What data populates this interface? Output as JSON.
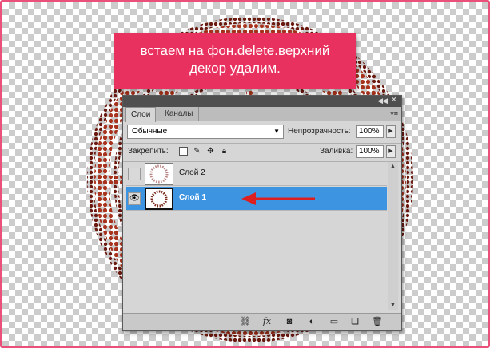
{
  "caption": {
    "line1": "встаем на фон.delete.верхний",
    "line2": "декор удалим."
  },
  "panel": {
    "tabs": [
      {
        "label": "Слои",
        "active": true
      },
      {
        "label": "Каналы",
        "active": false
      }
    ],
    "blend_mode": "Обычные",
    "opacity_label": "Непрозрачность:",
    "opacity_value": "100%",
    "lock_label": "Закрепить:",
    "fill_label": "Заливка:",
    "fill_value": "100%",
    "layers": [
      {
        "name": "Слой 2",
        "visible": false,
        "selected": false
      },
      {
        "name": "Слой 1",
        "visible": true,
        "selected": true
      }
    ]
  },
  "colors": {
    "accent": "#e8315f",
    "frame": "#e9507a",
    "selection": "#3d94e0",
    "arrow": "#dd1f1f"
  },
  "icons": {
    "lock_buttons": [
      "lock-transparent-icon",
      "lock-image-icon",
      "lock-position-icon",
      "lock-all-icon"
    ],
    "bottom_buttons": [
      "link-layers-icon",
      "fx-icon",
      "add-mask-icon",
      "adjustment-layer-icon",
      "new-group-icon",
      "new-layer-icon",
      "trash-icon"
    ]
  }
}
